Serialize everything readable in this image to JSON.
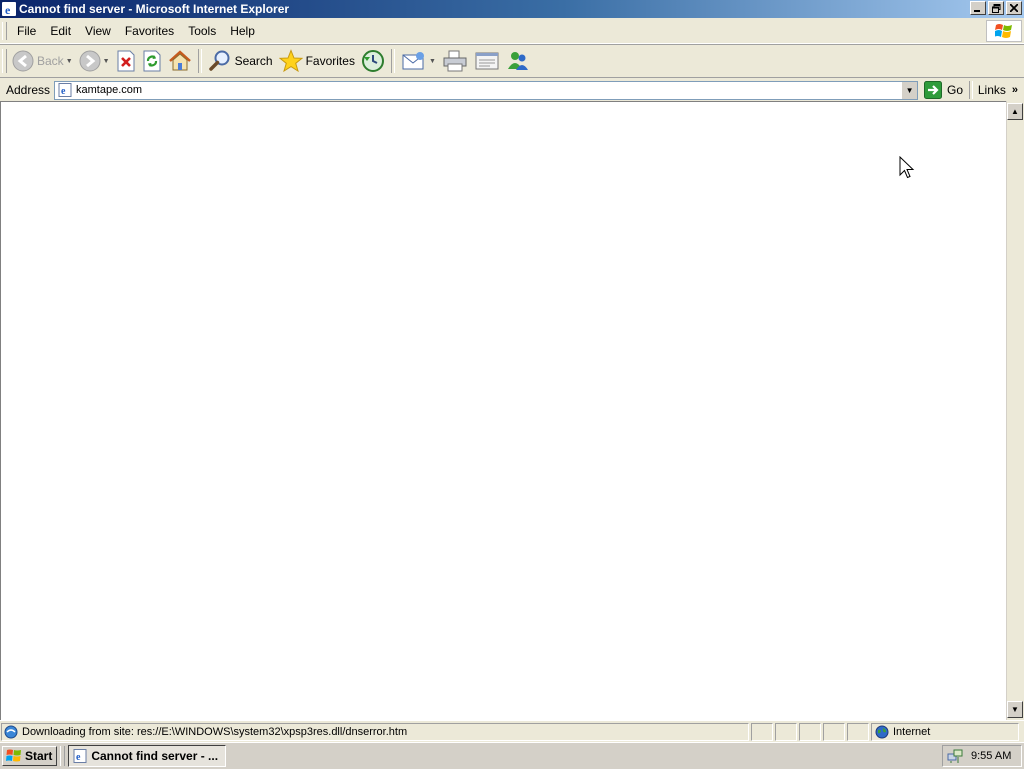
{
  "window": {
    "title": "Cannot find server - Microsoft Internet Explorer"
  },
  "menu": [
    "File",
    "Edit",
    "View",
    "Favorites",
    "Tools",
    "Help"
  ],
  "toolbar": {
    "back_label": "Back",
    "search_label": "Search",
    "favorites_label": "Favorites"
  },
  "address": {
    "label": "Address",
    "value": "kamtape.com",
    "go_label": "Go",
    "links_label": "Links"
  },
  "status": {
    "text": "Downloading from site: res://E:\\WINDOWS\\system32\\xpsp3res.dll/dnserror.htm",
    "zone": "Internet"
  },
  "taskbar": {
    "start_label": "Start",
    "task_label": "Cannot find server - ...",
    "clock": "9:55 AM"
  },
  "colors": {
    "titlebar_start": "#0a246a",
    "titlebar_end": "#a6caf0",
    "chrome": "#ece9d8"
  }
}
